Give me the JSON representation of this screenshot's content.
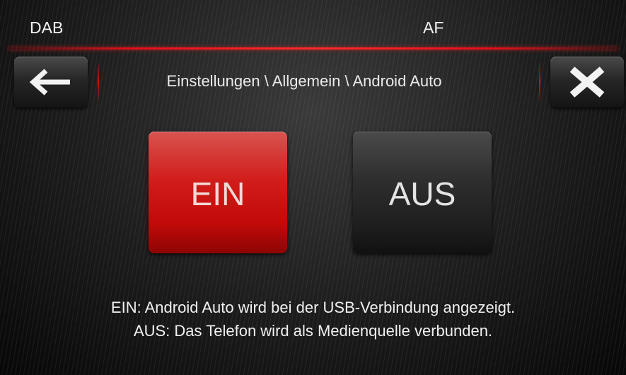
{
  "status_bar": {
    "left_label": "DAB",
    "center_label": "AF"
  },
  "nav": {
    "back_icon": "arrow-left-icon",
    "close_icon": "close-x-icon",
    "breadcrumb": "Einstellungen \\ Allgemein \\ Android Auto"
  },
  "toggle": {
    "on_label": "EIN",
    "off_label": "AUS",
    "selected": "EIN"
  },
  "info": {
    "line1": "EIN: Android Auto wird bei der USB-Verbindung angezeigt.",
    "line2": "AUS: Das Telefon wird als Medienquelle verbunden."
  },
  "colors": {
    "accent": "#e0101a",
    "selected_button": "#d11d1a",
    "background": "#1c1c1c",
    "text": "#f0f0f0"
  }
}
